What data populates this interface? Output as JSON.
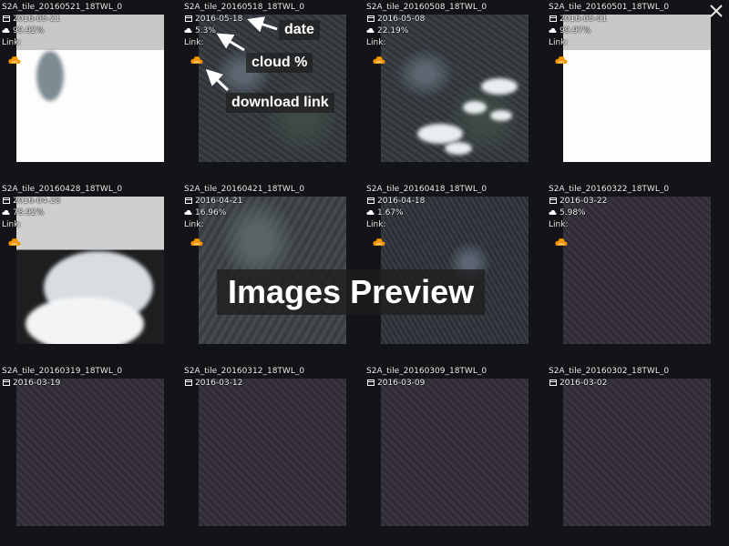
{
  "tiles": [
    {
      "title": "S2A_tile_20160521_18TWL_0",
      "date": "2016-05-21",
      "cloud": "99.92%",
      "link_label": "Link:",
      "swath": "white-clouds"
    },
    {
      "title": "S2A_tile_20160518_18TWL_0",
      "date": "2016-05-18",
      "cloud": "5.3%",
      "link_label": "Link:",
      "swath": "terrain"
    },
    {
      "title": "S2A_tile_20160508_18TWL_0",
      "date": "2016-05-08",
      "cloud": "22.19%",
      "link_label": "Link:",
      "swath": "scattered-clouds"
    },
    {
      "title": "S2A_tile_20160501_18TWL_0",
      "date": "2016-05-01",
      "cloud": "99.97%",
      "link_label": "Link:",
      "swath": "white"
    },
    {
      "title": "S2A_tile_20160428_18TWL_0",
      "date": "2016-04-28",
      "cloud": "78.92%",
      "link_label": "Link:",
      "swath": "heavy-clouds"
    },
    {
      "title": "S2A_tile_20160421_18TWL_0",
      "date": "2016-04-21",
      "cloud": "16.96%",
      "link_label": "Link:",
      "swath": "mountain"
    },
    {
      "title": "S2A_tile_20160418_18TWL_0",
      "date": "2016-04-18",
      "cloud": "1.67%",
      "link_label": "Link:",
      "swath": "city"
    },
    {
      "title": "S2A_tile_20160322_18TWL_0",
      "date": "2016-03-22",
      "cloud": "5.98%",
      "link_label": "Link:",
      "swath": "dark"
    },
    {
      "title": "S2A_tile_20160319_18TWL_0",
      "date": "2016-03-19",
      "cloud": "",
      "link_label": "",
      "swath": "dark"
    },
    {
      "title": "S2A_tile_20160312_18TWL_0",
      "date": "2016-03-12",
      "cloud": "",
      "link_label": "",
      "swath": "dark"
    },
    {
      "title": "S2A_tile_20160309_18TWL_0",
      "date": "2016-03-09",
      "cloud": "",
      "link_label": "",
      "swath": "dark"
    },
    {
      "title": "S2A_tile_20160302_18TWL_0",
      "date": "2016-03-02",
      "cloud": "",
      "link_label": "",
      "swath": "dark"
    }
  ],
  "annotations": {
    "date": "date",
    "cloud": "cloud %",
    "link": "download link",
    "preview": "Images Preview"
  },
  "icons": {
    "calendar": "calendar-icon",
    "cloud": "cloud-icon",
    "aws": "aws-download-icon",
    "close": "close-icon"
  },
  "colors": {
    "background": "#121417",
    "aws_orange": "#f79400",
    "annotation_bg": "#1e1e1e"
  }
}
